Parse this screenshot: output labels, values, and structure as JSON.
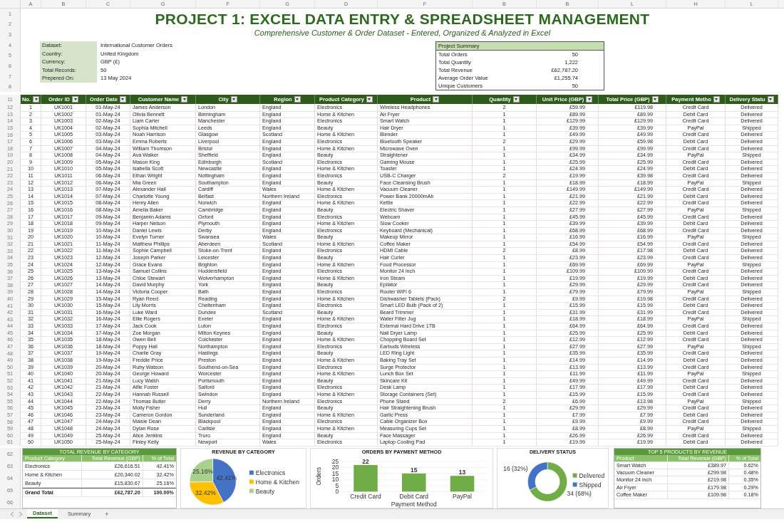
{
  "column_letters": [
    "A",
    "B",
    "C",
    "G",
    "F",
    "G",
    "D",
    "F",
    "B",
    "B",
    "L",
    "H",
    "L"
  ],
  "top_row_numbers": [
    "1",
    "2",
    "3",
    "4",
    "5",
    "6",
    "7",
    "8"
  ],
  "title": "PROJECT 1: EXCEL DATA ENTRY & SPREADSHEET MANAGEMENT",
  "subtitle": "Comprehensive Customer & Order Dataset - Entered, Organized & Analyzed in Excel",
  "info": [
    {
      "label": "Dataset:",
      "value": "International Customer Orders"
    },
    {
      "label": "Country:",
      "value": "United Kingdom"
    },
    {
      "label": "Currency:",
      "value": "GBP (£)"
    },
    {
      "label": "Total Records:",
      "value": "50"
    },
    {
      "label": "Prepered On:",
      "value": "13 May 2024"
    }
  ],
  "summary": {
    "title": "Project Summary",
    "items": [
      {
        "label": "Total Orders",
        "value": "50"
      },
      {
        "label": "Total Quantity",
        "value": "1,222"
      },
      {
        "label": "Total Revenue",
        "value": "£62,787.20"
      },
      {
        "label": "Average Order Value",
        "value": "£1,255.74"
      },
      {
        "label": "Unique Customers",
        "value": "50"
      }
    ]
  },
  "table": {
    "row_number": "11",
    "columns": [
      "No.",
      "Order ID",
      "Order Date",
      "Customer Name",
      "City",
      "Region",
      "Product Category",
      "Product",
      "Quantity",
      "Unit Price (GBP)",
      "Total Price (GBP)",
      "Payment Metho",
      "Delivery Statu"
    ],
    "rows": [
      {
        "row": "12",
        "cells": [
          "1",
          "UK1001",
          "01-May-24",
          "James Anderson",
          "London",
          "England",
          "Electronics",
          "Wireless Headphones",
          "2",
          "£59.99",
          "£119.98",
          "Credit Card",
          "Delivered"
        ]
      },
      {
        "row": "13",
        "cells": [
          "2",
          "UK1002",
          "01-May-24",
          "Olivia Bennett",
          "Birmingham",
          "England",
          "Home & Kitchen",
          "Air Fryer",
          "1",
          "£89.99",
          "£89.99",
          "Debit Card",
          "Delivered"
        ]
      },
      {
        "row": "14",
        "cells": [
          "3",
          "UK1003",
          "02-May-24",
          "Liam Carter",
          "Manchester",
          "England",
          "Electronics",
          "Smart Watch",
          "1",
          "£129.99",
          "£129.99",
          "Credit Card",
          "Delivered"
        ]
      },
      {
        "row": "15",
        "cells": [
          "4",
          "UK1004",
          "02-May-24",
          "Sophia Mitchell",
          "Leeds",
          "England",
          "Beauty",
          "Hair Dryer",
          "1",
          "£39.99",
          "£39.99",
          "PayPal",
          "Shipped"
        ]
      },
      {
        "row": "16",
        "cells": [
          "5",
          "UK1005",
          "03-May-24",
          "Noah Harrison",
          "Glasgow",
          "Scotland",
          "Home & Kitchen",
          "Blender",
          "1",
          "£49.99",
          "£49.99",
          "Credit Card",
          "Delivered"
        ]
      },
      {
        "row": "17",
        "cells": [
          "6",
          "UK1006",
          "03-May-24",
          "Emma Roberts",
          "Liverpool",
          "England",
          "Electronics",
          "Bluetooth Speaker",
          "2",
          "£29.99",
          "£59.98",
          "Debit Card",
          "Delivered"
        ]
      },
      {
        "row": "18",
        "cells": [
          "7",
          "UK1007",
          "04-May-24",
          "William Thomson",
          "Bristol",
          "England",
          "Home & Kitchen",
          "Microwave Oven",
          "1",
          "£99.99",
          "£99.99",
          "Credit Card",
          "Delivered"
        ]
      },
      {
        "row": "19",
        "cells": [
          "8",
          "UK1008",
          "04-May-24",
          "Ava Walker",
          "Sheffield",
          "England",
          "Beauty",
          "Straightener",
          "1",
          "£34.99",
          "£34.99",
          "PayPal",
          "Shipped"
        ]
      },
      {
        "row": "20",
        "cells": [
          "9",
          "UK1009",
          "05-May-24",
          "Mason King",
          "Edinburgh",
          "Scotland",
          "Electronics",
          "Gaming Mouse",
          "1",
          "£25.99",
          "£25.99",
          "Credit Card",
          "Delivered"
        ]
      },
      {
        "row": "21",
        "cells": [
          "10",
          "UK1010",
          "05-May-24",
          "Isabella Scott",
          "Newcastle",
          "England",
          "Home & Kitchen",
          "Toaster",
          "1",
          "£24.99",
          "£24.99",
          "Debit Card",
          "Delivered"
        ]
      },
      {
        "row": "22",
        "cells": [
          "11",
          "UK1011",
          "06-May-24",
          "Ethan Wright",
          "Nottingham",
          "England",
          "Electronics",
          "USB-C Charger",
          "2",
          "£19.99",
          "£39.98",
          "Credit Card",
          "Delivered"
        ]
      },
      {
        "row": "23",
        "cells": [
          "12",
          "UK1012",
          "06-May-24",
          "Mia Green",
          "Southampton",
          "England",
          "Beauty",
          "Face Cleansing Brush",
          "1",
          "£18.99",
          "£18.99",
          "PayPal",
          "Shipped"
        ]
      },
      {
        "row": "24",
        "cells": [
          "13",
          "UK1013",
          "07-May-24",
          "Alexander Hall",
          "Cardiff",
          "Wales",
          "Home & Kitchen",
          "Vacuum Cleaner",
          "1",
          "£149.99",
          "£149.99",
          "Credit Card",
          "Delivered"
        ]
      },
      {
        "row": "25",
        "cells": [
          "14",
          "UK1014",
          "07-May-24",
          "Charlotte Young",
          "Belfast",
          "Northern Ireland",
          "Electronics",
          "Power Bank 20000mAh",
          "1",
          "£21.99",
          "£21.99",
          "Debit Card",
          "Delivered"
        ]
      },
      {
        "row": "26",
        "cells": [
          "15",
          "UK1015",
          "08-May-24",
          "Henry Allen",
          "Norwich",
          "England",
          "Home & Kitchen",
          "Kettle",
          "1",
          "£22.99",
          "£22.99",
          "Credit Card",
          "Delivered"
        ]
      },
      {
        "row": "27",
        "cells": [
          "16",
          "UK1016",
          "08-May-24",
          "Amelia Baker",
          "Cambridge",
          "England",
          "Beauty",
          "Electric Shaver",
          "1",
          "£27.99",
          "£27.99",
          "PayPal",
          "Shipped"
        ]
      },
      {
        "row": "28",
        "cells": [
          "17",
          "UK1017",
          "09-May-24",
          "Benjamin Adams",
          "Oxford",
          "England",
          "Electronics",
          "Webcam",
          "1",
          "£45.99",
          "£45.99",
          "Credit Card",
          "Delivered"
        ]
      },
      {
        "row": "29",
        "cells": [
          "18",
          "UK1018",
          "09-May-24",
          "Harper Nelson",
          "Plymouth",
          "England",
          "Home & Kitchen",
          "Slow Cooker",
          "1",
          "£39.99",
          "£39.99",
          "Debit Card",
          "Delivered"
        ]
      },
      {
        "row": "30",
        "cells": [
          "19",
          "UK1019",
          "10-May-24",
          "Daniel Lewis",
          "Derby",
          "England",
          "Electronics",
          "Keyboard (Mechanical)",
          "1",
          "£68.99",
          "£68.99",
          "Credit Card",
          "Delivered"
        ]
      },
      {
        "row": "31",
        "cells": [
          "20",
          "UK1020",
          "10-May-24",
          "Evelyn Turner",
          "Swansea",
          "Wales",
          "Beauty",
          "Makeup Mirror",
          "1",
          "£16.99",
          "£16.99",
          "PayPal",
          "Shipped"
        ]
      },
      {
        "row": "32",
        "cells": [
          "21",
          "UK1021",
          "11-May-24",
          "Matthew Phillips",
          "Aberdeen",
          "Scotland",
          "Home & Kitchen",
          "Coffee Maker",
          "1",
          "£54.99",
          "£54.99",
          "Credit Card",
          "Delivered"
        ]
      },
      {
        "row": "33",
        "cells": [
          "22",
          "UK1022",
          "11-May-24",
          "Sophie Campbell",
          "Stoke-on-Trent",
          "England",
          "Electronics",
          "HDMI Cable",
          "2",
          "£8.99",
          "£17.98",
          "Debit Card",
          "Delivered"
        ]
      },
      {
        "row": "34",
        "cells": [
          "23",
          "UK1023",
          "12-May-24",
          "Joseph Parker",
          "Leicester",
          "England",
          "Beauty",
          "Hair Curler",
          "1",
          "£23.99",
          "£23.99",
          "Credit Card",
          "Delivered"
        ]
      },
      {
        "row": "35",
        "cells": [
          "24",
          "UK1024",
          "12-May-24",
          "Grace Evans",
          "Brighton",
          "England",
          "Home & Kitchen",
          "Food Processor",
          "1",
          "£69.99",
          "£69.99",
          "PayPal",
          "Shipped"
        ]
      },
      {
        "row": "36",
        "cells": [
          "25",
          "UK1025",
          "13-May-24",
          "Samuel Collins",
          "Huddersfield",
          "England",
          "Electronics",
          "Monitor 24 inch",
          "1",
          "£109.99",
          "£109.99",
          "Credit Card",
          "Delivered"
        ]
      },
      {
        "row": "37",
        "cells": [
          "26",
          "UK1026",
          "13-May-24",
          "Chloe Stewart",
          "Wolverhampton",
          "England",
          "Home & Kitchen",
          "Iron Steam",
          "1",
          "£19.99",
          "£19.99",
          "Debit Card",
          "Delivered"
        ]
      },
      {
        "row": "38",
        "cells": [
          "27",
          "UK1027",
          "14-May-24",
          "David Murphy",
          "York",
          "England",
          "Beauty",
          "Epilator",
          "1",
          "£29.99",
          "£29.99",
          "Credit Card",
          "Delivered"
        ]
      },
      {
        "row": "39",
        "cells": [
          "28",
          "UK1028",
          "14-May-24",
          "Victoria Cooper",
          "Bath",
          "England",
          "Electronics",
          "Router WiFi 6",
          "1",
          "£79.99",
          "£79.99",
          "PayPal",
          "Shipped"
        ]
      },
      {
        "row": "40",
        "cells": [
          "29",
          "UK1029",
          "15-May-24",
          "Ryan Reed",
          "Reading",
          "England",
          "Home & Kitchen",
          "Dishwasher Tablets (Pack)",
          "2",
          "£9.99",
          "£19.98",
          "Credit Card",
          "Delivered"
        ]
      },
      {
        "row": "41",
        "cells": [
          "30",
          "UK1030",
          "15-May-24",
          "Lily Morris",
          "Cheltenham",
          "England",
          "Electronics",
          "Smart LED Bulb (Pack of 2)",
          "1",
          "£15.99",
          "£15.99",
          "Debit Card",
          "Delivered"
        ]
      },
      {
        "row": "42",
        "cells": [
          "31",
          "UK1031",
          "16-May-24",
          "Luke Ward",
          "Dundee",
          "Scotland",
          "Beauty",
          "Beard Trimmer",
          "1",
          "£31.99",
          "£31.99",
          "Credit Card",
          "Delivered"
        ]
      },
      {
        "row": "43",
        "cells": [
          "32",
          "UK1032",
          "16-May-24",
          "Ellie Rogers",
          "Exeter",
          "England",
          "Home & Kitchen",
          "Water Filter Jug",
          "1",
          "£18.99",
          "£18.99",
          "PayPal",
          "Shipped"
        ]
      },
      {
        "row": "44",
        "cells": [
          "33",
          "UK1033",
          "17-May-24",
          "Jack Cook",
          "Luton",
          "England",
          "Electronics",
          "External Hard Drive 1TB",
          "1",
          "£64.99",
          "£64.99",
          "Credit Card",
          "Delivered"
        ]
      },
      {
        "row": "45",
        "cells": [
          "34",
          "UK1034",
          "17-May-24",
          "Zoe Morgan",
          "Milton Keynes",
          "England",
          "Beauty",
          "Nail Dryer Lamp",
          "1",
          "£25.99",
          "£25.99",
          "Debit Card",
          "Delivered"
        ]
      },
      {
        "row": "46",
        "cells": [
          "35",
          "UK1035",
          "18-May-24",
          "Owen Bell",
          "Colchester",
          "England",
          "Home & Kitchen",
          "Chopping Board Set",
          "1",
          "£12.99",
          "£12.99",
          "Credit Card",
          "Delivered"
        ]
      },
      {
        "row": "47",
        "cells": [
          "36",
          "UK1036",
          "18-May-24",
          "Poppy Hall",
          "Northampton",
          "England",
          "Electronics",
          "Earbuds Wireless",
          "1",
          "£27.99",
          "£27.99",
          "PayPal",
          "Shipped"
        ]
      },
      {
        "row": "48",
        "cells": [
          "37",
          "UK1037",
          "19-May-24",
          "Charlie Gray",
          "Hastings",
          "England",
          "Beauty",
          "LED Ring Light",
          "1",
          "£35.99",
          "£35.99",
          "Credit Card",
          "Delivered"
        ]
      },
      {
        "row": "49",
        "cells": [
          "38",
          "UK1038",
          "19-May-24",
          "Freddie Price",
          "Preston",
          "England",
          "Home & Kitchen",
          "Baking Tray Set",
          "1",
          "£14.99",
          "£14.99",
          "Debit Card",
          "Delivered"
        ]
      },
      {
        "row": "50",
        "cells": [
          "39",
          "UK1039",
          "20-May-24",
          "Ruby Watson",
          "Southend-on-Sea",
          "England",
          "Electronics",
          "Surge Protector",
          "1",
          "£13.99",
          "£13.99",
          "Credit Card",
          "Delivered"
        ]
      },
      {
        "row": "51",
        "cells": [
          "40",
          "UK1040",
          "20-May-24",
          "George Howard",
          "Worcester",
          "England",
          "Home & Kitchen",
          "Lunch Box Set",
          "1",
          "£11.99",
          "£11.99",
          "PayPal",
          "Shipped"
        ]
      },
      {
        "row": "52",
        "cells": [
          "41",
          "UK1041",
          "21-May-24",
          "Lucy Walsh",
          "Portsmouth",
          "England",
          "Beauty",
          "Skincare Kit",
          "1",
          "£49.99",
          "£49.99",
          "Credit Card",
          "Delivered"
        ]
      },
      {
        "row": "53",
        "cells": [
          "42",
          "UK1042",
          "21-May-24",
          "Alfie Foster",
          "Salford",
          "England",
          "Electronics",
          "Desk Lamp",
          "1",
          "£17.99",
          "£17.99",
          "Debit Card",
          "Delivered"
        ]
      },
      {
        "row": "54",
        "cells": [
          "43",
          "UK1043",
          "22-May-24",
          "Hannah Russell",
          "Swindon",
          "England",
          "Home & Kitchen",
          "Storage Containers (Set)",
          "1",
          "£15.99",
          "£15.99",
          "Credit Card",
          "Delivered"
        ]
      },
      {
        "row": "55",
        "cells": [
          "44",
          "UK1044",
          "22-May-24",
          "Thomas Butler",
          "Derry",
          "Northern Ireland",
          "Electronics",
          "Phone Stand",
          "2",
          "£6.99",
          "£13.98",
          "PayPal",
          "Shipped"
        ]
      },
      {
        "row": "56",
        "cells": [
          "45",
          "UK1045",
          "23-May-24",
          "Molly Fisher",
          "Hull",
          "England",
          "Beauty",
          "Hair Straightening Brush",
          "1",
          "£29.99",
          "£29.99",
          "Credit Card",
          "Delivered"
        ]
      },
      {
        "row": "57",
        "cells": [
          "46",
          "UK1046",
          "23-May-24",
          "Cameron Gordon",
          "Sunderland",
          "England",
          "Home & Kitchen",
          "Garlic Press",
          "1",
          "£7.99",
          "£7.99",
          "Debit Card",
          "Delivered"
        ]
      },
      {
        "row": "58",
        "cells": [
          "47",
          "UK1047",
          "24-May-24",
          "Maisie Dean",
          "Blackpool",
          "England",
          "Electronics",
          "Cable Organizer Box",
          "1",
          "£9.99",
          "£9.99",
          "Credit Card",
          "Delivered"
        ]
      },
      {
        "row": "59",
        "cells": [
          "48",
          "UK1048",
          "24-May-24",
          "Dylan Rose",
          "Carlisle",
          "England",
          "Home & Kitchen",
          "Measuring Cups Set",
          "1",
          "£8.99",
          "£8.99",
          "PayPal",
          "Shipped"
        ]
      },
      {
        "row": "60",
        "cells": [
          "49",
          "UK1049",
          "25-May-24",
          "Alice Jenkins",
          "Truro",
          "England",
          "Beauty",
          "Face Massager",
          "1",
          "£26.99",
          "£26.99",
          "Credit Card",
          "Delivered"
        ]
      },
      {
        "row": "61",
        "cells": [
          "50",
          "UK1050",
          "25-May-24",
          "Finley Kelly",
          "Newport",
          "Wales",
          "Electronics",
          "Laptop Cooling Pad",
          "1",
          "£19.99",
          "£19.99",
          "Debit Card",
          "Delivered"
        ]
      }
    ]
  },
  "bottom_row_numbers": [
    "62",
    "63",
    "64",
    "65",
    "66"
  ],
  "category_table": {
    "title": "TOTAL REVENUE BY CATEGORY",
    "columns": [
      "Product Category",
      "Total Revenue (GBP)",
      "% of Total"
    ],
    "rows": [
      [
        "Electronics",
        "£26,616.51",
        "42.41%"
      ],
      [
        "Home & Kitchen",
        "£20,340.02",
        "32.42%"
      ],
      [
        "Beauty",
        "£15,830.67",
        "25.16%"
      ]
    ],
    "total": [
      "Grand Total",
      "£62,787.20",
      "100.00%"
    ]
  },
  "revenue_pie": {
    "chart_data": {
      "type": "pie",
      "title": "REVENUE BY CATEGORY",
      "categories": [
        "Electronics",
        "Home & Kitchen",
        "Beauty"
      ],
      "values": [
        42.41,
        32.42,
        25.16
      ],
      "colors": [
        "#4472c4",
        "#ffc000",
        "#a9d18e"
      ],
      "legend": true,
      "value_labels": [
        "42.41%",
        "32.42%",
        "25.16%"
      ]
    }
  },
  "payment_bar": {
    "chart_data": {
      "type": "bar",
      "title": "ORDERS BY PAYMENT METHOD",
      "xlabel": "Payment Method",
      "ylabel": "Orders",
      "categories": [
        "Credit Card",
        "Debit Card",
        "PayPal"
      ],
      "values": [
        22,
        15,
        13
      ],
      "ylim": [
        0,
        25
      ],
      "yticks": [
        0,
        5,
        10,
        15,
        20,
        25
      ],
      "grid": true,
      "data_labels": true
    }
  },
  "delivery_donut": {
    "chart_data": {
      "type": "donut",
      "title": "DELIVERY STATUS",
      "categories": [
        "Delivered",
        "Shipped"
      ],
      "values": [
        34,
        16
      ],
      "colors": [
        "#70ad47",
        "#4472c4"
      ],
      "legend": true,
      "value_labels": [
        "34 (68%)",
        "16 (32%)"
      ]
    }
  },
  "top_products": {
    "title": "TOP 5 PRODUCTS BY REVENUE",
    "columns": [
      "Product",
      "Total Revenue (GBP)",
      "% of Total"
    ],
    "rows": [
      [
        "Smart Watch",
        "£389.97",
        "0.62%"
      ],
      [
        "Vacuum Cleaner",
        "£299.98",
        "0.48%"
      ],
      [
        "Monitor 24 inch",
        "£219.98",
        "0.35%"
      ],
      [
        "Air Fryer",
        "£179.98",
        "0.29%"
      ],
      [
        "Coffee Maker",
        "£109.98",
        "0.18%"
      ]
    ]
  },
  "sheet_tabs": [
    {
      "label": "Dataset",
      "selected": true
    },
    {
      "label": "Summary",
      "selected": false
    }
  ],
  "add_sheet": "+"
}
